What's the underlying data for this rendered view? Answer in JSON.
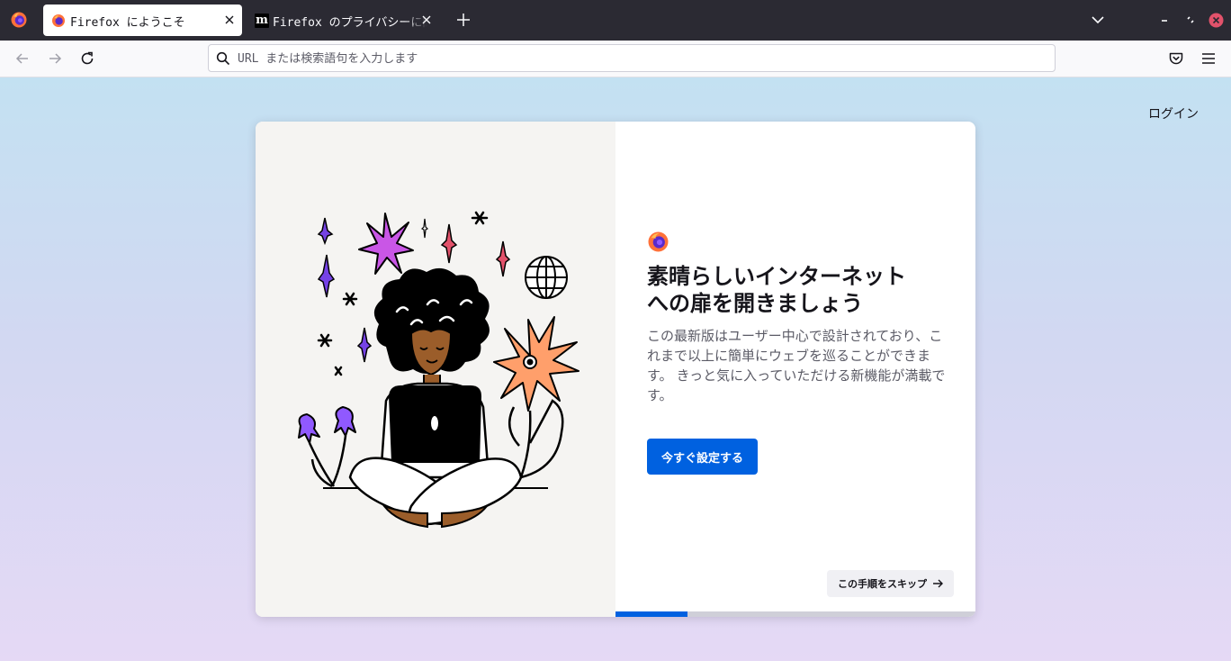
{
  "browser": {
    "tabs": [
      {
        "title": "Firefox にようこそ",
        "favicon": "firefox-icon",
        "active": true
      },
      {
        "title": "Firefox のプライバシーに関する通知",
        "favicon": "mozilla-m-icon",
        "active": false
      }
    ],
    "urlbar": {
      "placeholder": "URL または検索語句を入力します",
      "value": ""
    },
    "accent": "#0061e0",
    "mozilla_favicon_letter": "m"
  },
  "page": {
    "login_label": "ログイン",
    "onboarding": {
      "heading": "素晴らしいインターネット\nへの扉を開きましょう",
      "body": "この最新版はユーザー中心で設計されており、これまで以上に簡単にウェブを巡ることができます。 きっと気に入っていただける新機能が満載です。",
      "primary_button": "今すぐ設定する",
      "skip_button": "この手順をスキップ",
      "progress": 0.2
    }
  }
}
